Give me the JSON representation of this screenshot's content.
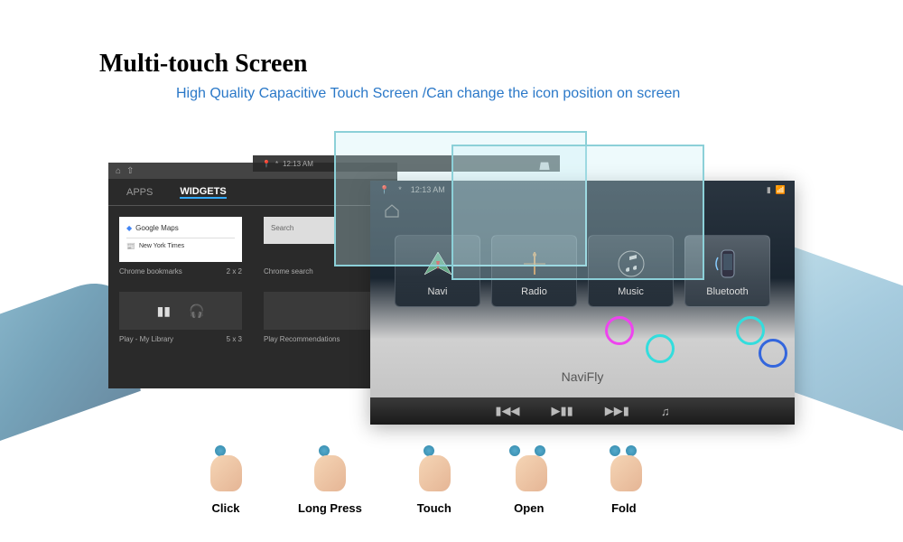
{
  "heading": "Multi-touch Screen",
  "subheading": "High Quality Capacitive Touch Screen /Can change the icon position on screen",
  "apps_screen": {
    "tabs": [
      "APPS",
      "WIDGETS"
    ],
    "active_tab": 1,
    "col1": {
      "card1": "Google Maps",
      "card2": "New York Times",
      "label1": "Chrome bookmarks",
      "size1": "2 x 2",
      "label2": "Play - My Library",
      "size2": "5 x 3"
    },
    "col2": {
      "search": "Search",
      "label1": "Chrome search",
      "label2": "Play Recommendations"
    }
  },
  "small_statusbar": {
    "time": "12:13 AM"
  },
  "main_screen": {
    "status": {
      "time": "12:13 AM"
    },
    "apps": [
      {
        "label": "Navi"
      },
      {
        "label": "Radio"
      },
      {
        "label": "Music"
      },
      {
        "label": "Bluetooth"
      }
    ],
    "brand": "NaviFly"
  },
  "gestures": [
    {
      "label": "Click"
    },
    {
      "label": "Long Press"
    },
    {
      "label": "Touch"
    },
    {
      "label": "Open"
    },
    {
      "label": "Fold"
    }
  ]
}
